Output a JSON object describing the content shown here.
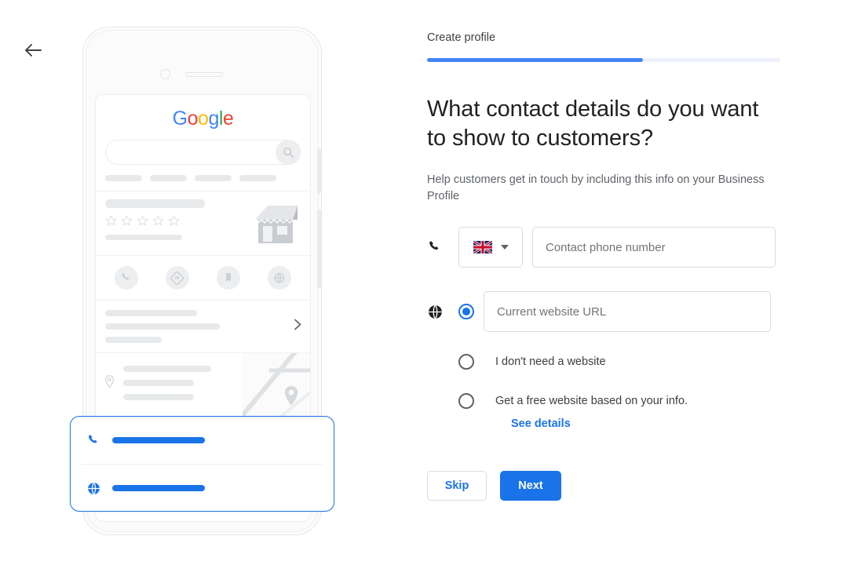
{
  "nav": {
    "back_icon": "arrow-left-icon"
  },
  "progress": {
    "step_label": "Create profile",
    "percent": 61
  },
  "main": {
    "heading": "What contact details do you want to show to customers?",
    "subtitle": "Help customers get in touch by including this info on your Business Profile"
  },
  "phone_field": {
    "icon": "phone-icon",
    "country_flag": "uk-flag",
    "dropdown_icon": "caret-down-icon",
    "placeholder": "Contact phone number",
    "value": ""
  },
  "website": {
    "icon": "globe-icon",
    "options": [
      {
        "label": "",
        "selected": true,
        "has_input": true
      },
      {
        "label": "I don't need a website",
        "selected": false,
        "has_input": false
      },
      {
        "label": "Get a free website based on your info.",
        "selected": false,
        "has_input": false
      }
    ],
    "url_placeholder": "Current website URL",
    "url_value": "",
    "details_link": "See details"
  },
  "actions": {
    "skip_label": "Skip",
    "next_label": "Next"
  },
  "illustration": {
    "logo": [
      "G",
      "o",
      "o",
      "g",
      "l",
      "e"
    ],
    "search_icon": "magnifier-icon",
    "action_icons": [
      "phone-icon",
      "directions-icon",
      "bookmark-icon",
      "globe-icon"
    ],
    "chevron_icon": "chevron-right-icon",
    "location_icon": "map-pin-icon",
    "map_pin_icon": "map-pin-icon",
    "hours_icon": "clock-icon",
    "callout_icons": [
      "phone-icon",
      "globe-icon"
    ],
    "rating_stars": 5
  },
  "colors": {
    "accent_blue": "#1a73e8",
    "progress_blue": "#4285f4",
    "progress_track": "#eef1fb",
    "text_primary": "#202124",
    "text_secondary": "#5f6368",
    "border": "#dadce0",
    "placeholder_gray": "#e7e9eb"
  }
}
